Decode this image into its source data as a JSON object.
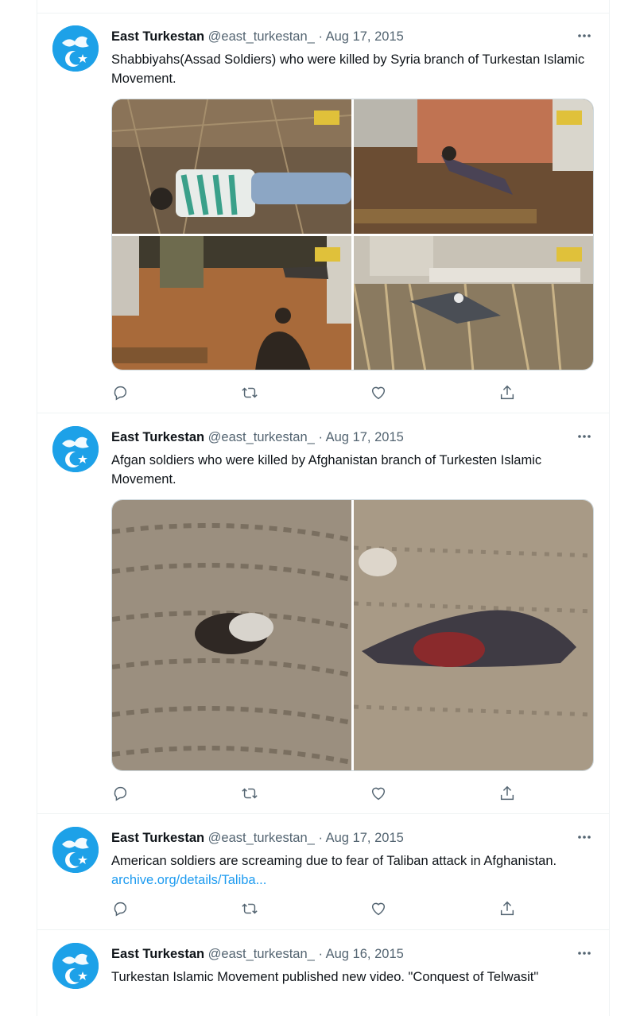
{
  "tweets": [
    {
      "name": "East Turkestan",
      "handle": "@east_turkestan_",
      "sep": "·",
      "date": "Aug 17, 2015",
      "text": "Shabbiyahs(Assad Soldiers) who were killed by Syria branch of Turkestan Islamic Movement.",
      "media": "4 photos"
    },
    {
      "name": "East Turkestan",
      "handle": "@east_turkestan_",
      "sep": "·",
      "date": "Aug 17, 2015",
      "text": "Afgan soldiers who were killed by Afghanistan branch of Turkesten Islamic Movement.",
      "media": "2 photos"
    },
    {
      "name": "East Turkestan",
      "handle": "@east_turkestan_",
      "sep": "·",
      "date": "Aug 17, 2015",
      "text": "American soldiers are screaming due to fear of Taliban attack in Afghanistan.",
      "link": "archive.org/details/Taliba..."
    },
    {
      "name": "East Turkestan",
      "handle": "@east_turkestan_",
      "sep": "·",
      "date": "Aug 16, 2015",
      "text": "Turkestan Islamic Movement published new video. \"Conquest of Telwasit\""
    }
  ],
  "icons": {
    "reply": "reply-icon",
    "retweet": "retweet-icon",
    "like": "like-icon",
    "share": "share-icon",
    "more": "more-icon"
  },
  "colors": {
    "avatar": "#1da1e8",
    "link": "#1d9bf0",
    "secondary_text": "#536471",
    "border": "#eff3f4"
  }
}
